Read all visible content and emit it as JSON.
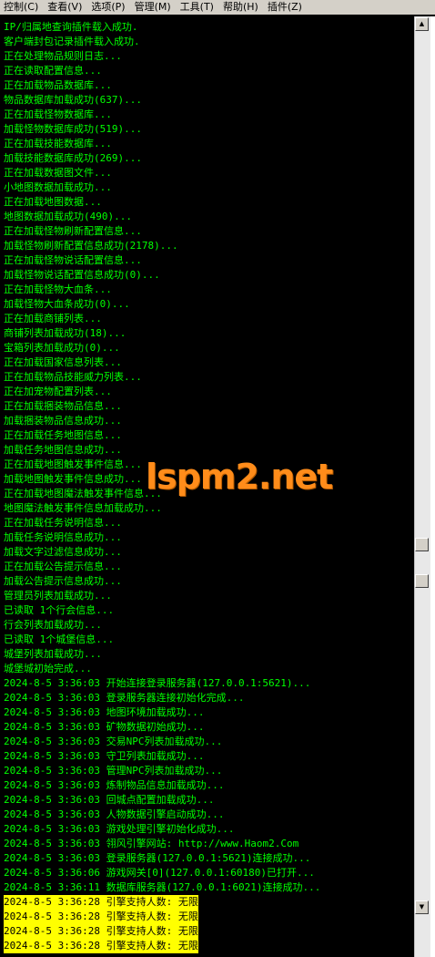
{
  "menu": [
    {
      "label": "控制(C)"
    },
    {
      "label": "查看(V)"
    },
    {
      "label": "选项(P)"
    },
    {
      "label": "管理(M)"
    },
    {
      "label": "工具(T)"
    },
    {
      "label": "帮助(H)"
    },
    {
      "label": "插件(Z)"
    }
  ],
  "log": [
    {
      "text": "IP/归属地查询插件载入成功."
    },
    {
      "text": "客户端封包记录插件载入成功."
    },
    {
      "text": "正在处理物品规则日志..."
    },
    {
      "text": "正在读取配置信息..."
    },
    {
      "text": "正在加载物品数据库..."
    },
    {
      "text": "物品数据库加载成功(637)..."
    },
    {
      "text": "正在加载怪物数据库..."
    },
    {
      "text": "加载怪物数据库成功(519)..."
    },
    {
      "text": "正在加载技能数据库..."
    },
    {
      "text": "加载技能数据库成功(269)..."
    },
    {
      "text": "正在加载数据图文件..."
    },
    {
      "text": "小地图数据加载成功..."
    },
    {
      "text": "正在加载地图数据..."
    },
    {
      "text": "地图数据加载成功(490)..."
    },
    {
      "text": "正在加载怪物刷新配置信息..."
    },
    {
      "text": "加载怪物刷新配置信息成功(2178)..."
    },
    {
      "text": "正在加载怪物说话配置信息..."
    },
    {
      "text": "加载怪物说话配置信息成功(0)..."
    },
    {
      "text": "正在加载怪物大血条..."
    },
    {
      "text": "加载怪物大血条成功(0)..."
    },
    {
      "text": "正在加载商铺列表..."
    },
    {
      "text": "商铺列表加载成功(18)..."
    },
    {
      "text": "宝箱列表加载成功(0)..."
    },
    {
      "text": "正在加载国家信息列表..."
    },
    {
      "text": "正在加载物品技能威力列表..."
    },
    {
      "text": "正在加宠物配置列表..."
    },
    {
      "text": "正在加载捆装物品信息..."
    },
    {
      "text": "加载捆装物品信息成功..."
    },
    {
      "text": "正在加载任务地图信息..."
    },
    {
      "text": "加载任务地图信息成功..."
    },
    {
      "text": "正在加载地图触发事件信息..."
    },
    {
      "text": "加载地图触发事件信息成功..."
    },
    {
      "text": "正在加载地图魔法触发事件信息..."
    },
    {
      "text": "地图魔法触发事件信息加载成功..."
    },
    {
      "text": "正在加载任务说明信息..."
    },
    {
      "text": "加载任务说明信息成功..."
    },
    {
      "text": "加载文字过滤信息成功..."
    },
    {
      "text": "正在加载公告提示信息..."
    },
    {
      "text": "加载公告提示信息成功..."
    },
    {
      "text": "管理员列表加载成功..."
    },
    {
      "text": "已读取 1个行会信息..."
    },
    {
      "text": "行会列表加载成功..."
    },
    {
      "text": "已读取 1个城堡信息..."
    },
    {
      "text": "城堡列表加载成功..."
    },
    {
      "text": "城堡城初始完成..."
    },
    {
      "text": "2024-8-5 3:36:03 开始连接登录服务器(127.0.0.1:5621)..."
    },
    {
      "text": "2024-8-5 3:36:03 登录服务器连接初始化完成..."
    },
    {
      "text": "2024-8-5 3:36:03 地图环境加载成功..."
    },
    {
      "text": "2024-8-5 3:36:03 矿物数据初始成功..."
    },
    {
      "text": "2024-8-5 3:36:03 交易NPC列表加载成功..."
    },
    {
      "text": "2024-8-5 3:36:03 守卫列表加载成功..."
    },
    {
      "text": "2024-8-5 3:36:03 管理NPC列表加载成功..."
    },
    {
      "text": "2024-8-5 3:36:03 炼制物品信息加载成功..."
    },
    {
      "text": "2024-8-5 3:36:03 回城点配置加载成功..."
    },
    {
      "text": "2024-8-5 3:36:03 人物数据引擎启动成功..."
    },
    {
      "text": "2024-8-5 3:36:03 游戏处理引擎初始化成功..."
    },
    {
      "text": "2024-8-5 3:36:03 翎风引擎网站: http://www.Haom2.Com"
    },
    {
      "text": "2024-8-5 3:36:03 登录服务器(127.0.0.1:5621)连接成功..."
    },
    {
      "text": "2024-8-5 3:36:06 游戏网关[0](127.0.0.1:60180)已打开..."
    },
    {
      "text": "2024-8-5 3:36:11 数据库服务器(127.0.0.1:6021)连接成功..."
    },
    {
      "text": "2024-8-5 3:36:28 引擎支持人数: 无限",
      "highlight": true
    },
    {
      "text": "2024-8-5 3:36:28 引擎支持人数: 无限",
      "highlight": true
    },
    {
      "text": "2024-8-5 3:36:28 引擎支持人数: 无限",
      "highlight": true
    },
    {
      "text": "2024-8-5 3:36:28 引擎支持人数: 无限",
      "highlight": true
    }
  ],
  "watermark": "lspm2.net",
  "scrollbar": {
    "up_glyph": "▲",
    "down_glyph": "▼"
  },
  "colors": {
    "console_bg": "#000000",
    "log_text": "#00ff00",
    "highlight_bg": "#ffff00",
    "highlight_text": "#000000",
    "menubar_bg": "#d4d0c8",
    "watermark": "#ff8c1a"
  }
}
